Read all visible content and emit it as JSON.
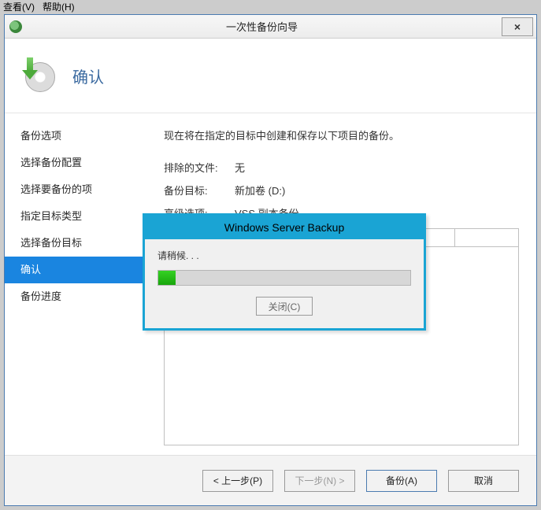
{
  "menubar": {
    "view": "查看(V)",
    "help": "帮助(H)"
  },
  "window": {
    "title": "一次性备份向导",
    "heading": "确认",
    "close_label": "×"
  },
  "sidebar": {
    "items": [
      {
        "label": "备份选项"
      },
      {
        "label": "选择备份配置"
      },
      {
        "label": "选择要备份的项"
      },
      {
        "label": "指定目标类型"
      },
      {
        "label": "选择备份目标"
      },
      {
        "label": "确认"
      },
      {
        "label": "备份进度"
      }
    ],
    "active_index": 5
  },
  "content": {
    "intro": "现在将在指定的目标中创建和保存以下项目的备份。",
    "rows": [
      {
        "k": "排除的文件:",
        "v": "无"
      },
      {
        "k": "备份目标:",
        "v": "新加卷 (D:)"
      },
      {
        "k": "高级选项:",
        "v": "VSS 副本备份"
      }
    ]
  },
  "footer": {
    "prev": "< 上一步(P)",
    "next": "下一步(N) >",
    "backup": "备份(A)",
    "cancel": "取消"
  },
  "dialog": {
    "title": "Windows Server Backup",
    "message": "请稍候. . .",
    "progress_percent": 7,
    "close_label": "关闭(C)"
  }
}
